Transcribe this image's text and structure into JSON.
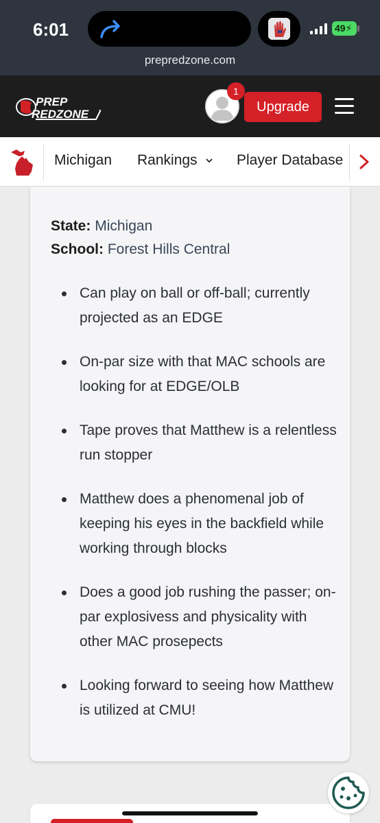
{
  "status_bar": {
    "time": "6:01",
    "battery": "49"
  },
  "browser": {
    "url": "prepredzone.com"
  },
  "header": {
    "logo_line1": "PREP",
    "logo_line2": "REDZONE",
    "notification_count": "1",
    "upgrade_label": "Upgrade"
  },
  "nav": {
    "items": [
      {
        "label": "Michigan"
      },
      {
        "label": "Rankings"
      },
      {
        "label": "Player Database"
      }
    ]
  },
  "profile": {
    "state_label": "State:",
    "state_value": "Michigan",
    "school_label": "School:",
    "school_value": "Forest Hills Central",
    "bullets": [
      "Can play on ball or off-ball; currently projected as an EDGE",
      "On-par size with that MAC schools are looking for at EDGE/OLB",
      "Tape proves that Matthew is a relentless run stopper",
      "Matthew does a phenomenal job of keeping his eyes in the backfield while working through blocks",
      "Does a good job rushing the passer; on-par explosivess and physicality with other MAC prosepects",
      "Looking forward to seeing how Matthew is utilized at CMU!"
    ]
  },
  "colors": {
    "brand_red": "#d42027",
    "header_bg": "#1d1d1d",
    "chrome_bg": "#2e353f"
  }
}
